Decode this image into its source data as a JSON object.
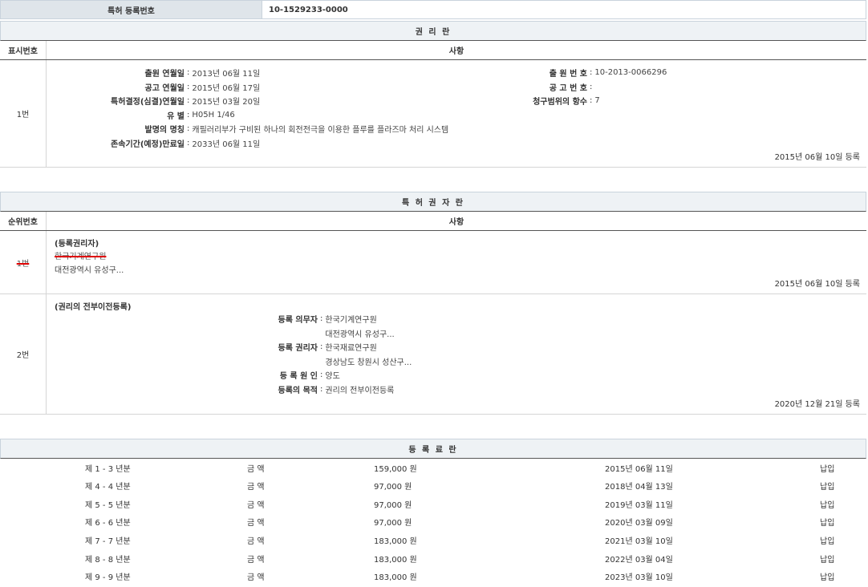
{
  "top": {
    "label": "특허 등록번호",
    "value": "10-1529233-0000"
  },
  "rights": {
    "title": "권 리 란",
    "col_num": "표시번호",
    "col_item": "사항",
    "row": {
      "num": "1번",
      "left": [
        {
          "k": "출원 연월일",
          "v": "2013년 06월 11일"
        },
        {
          "k": "공고 연월일",
          "v": "2015년 06월 17일"
        },
        {
          "k": "특허결정(심결)연월일",
          "v": "2015년 03월 20일"
        },
        {
          "k": "유 별",
          "v": "H05H 1/46"
        },
        {
          "k": "발명의 명칭",
          "v": "캐필러리부가 구비된 하나의 회전전극을 이용한 플루를 플라즈마 처리 시스템"
        },
        {
          "k": "존속기간(예정)만료일",
          "v": "2033년 06월 11일"
        }
      ],
      "right": [
        {
          "k": "출 원 번 호",
          "v": "10-2013-0066296"
        },
        {
          "k": "공 고 번 호",
          "v": ""
        },
        {
          "k": "청구범위의 항수",
          "v": "7"
        }
      ],
      "date": "2015년 06월 10일 등록"
    }
  },
  "holders": {
    "title": "특 허 권 자 란",
    "col_num": "순위번호",
    "col_item": "사항",
    "row1": {
      "num": "1번",
      "type": "(등록권리자)",
      "name": "한국기계연구원",
      "addr": "대전광역시 유성구...",
      "date": "2015년 06월 10일 등록"
    },
    "row2": {
      "num": "2번",
      "type": "(권리의 전부이전등록)",
      "items": [
        {
          "k": "등록 의무자",
          "v": "한국기계연구원"
        },
        {
          "k": "",
          "v": "대전광역시 유성구..."
        },
        {
          "k": "등록 권리자",
          "v": "한국재료연구원"
        },
        {
          "k": "",
          "v": "경상남도 창원시 성산구..."
        },
        {
          "k": "등 록 원 인",
          "v": "양도"
        },
        {
          "k": "등록의 목적",
          "v": "권리의 전부이전등록"
        }
      ],
      "date": "2020년 12월 21일 등록"
    }
  },
  "fees": {
    "title": "등 록 료 란",
    "rows": [
      {
        "period": "제 1 - 3 년분",
        "label": "금 액",
        "amount": "159,000 원",
        "date": "2015년 06월 11일",
        "status": "납입"
      },
      {
        "period": "제 4 - 4 년분",
        "label": "금 액",
        "amount": "97,000 원",
        "date": "2018년 04월 13일",
        "status": "납입"
      },
      {
        "period": "제 5 - 5 년분",
        "label": "금 액",
        "amount": "97,000 원",
        "date": "2019년 03월 11일",
        "status": "납입"
      },
      {
        "period": "제 6 - 6 년분",
        "label": "금 액",
        "amount": "97,000 원",
        "date": "2020년 03월 09일",
        "status": "납입"
      },
      {
        "period": "제 7 - 7 년분",
        "label": "금 액",
        "amount": "183,000 원",
        "date": "2021년 03월 10일",
        "status": "납입"
      },
      {
        "period": "제 8 - 8 년분",
        "label": "금 액",
        "amount": "183,000 원",
        "date": "2022년 03월 04일",
        "status": "납입"
      },
      {
        "period": "제 9 - 9 년분",
        "label": "금 액",
        "amount": "183,000 원",
        "date": "2023년 03월 10일",
        "status": "납입"
      }
    ]
  }
}
